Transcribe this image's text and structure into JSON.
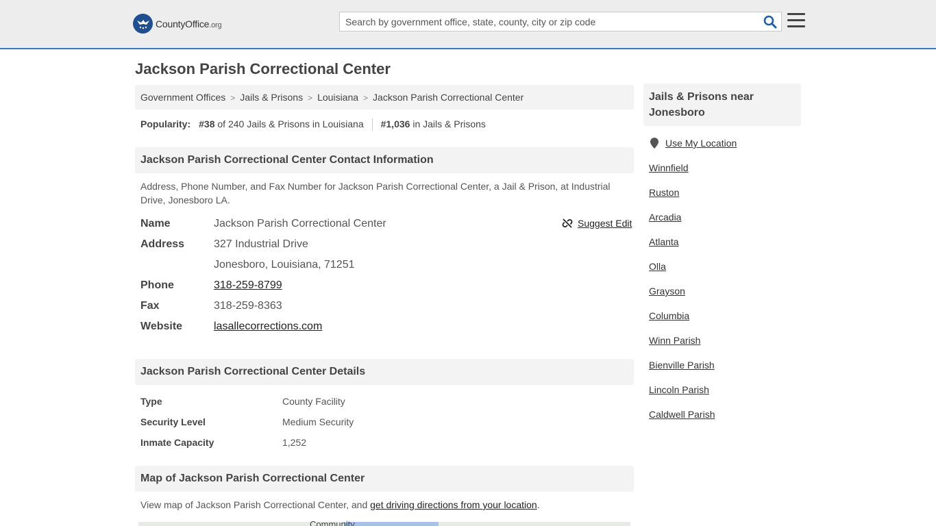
{
  "header": {
    "logo_text_main": "CountyOffice",
    "logo_text_org": ".org",
    "search_placeholder": "Search by government office, state, county, city or zip code"
  },
  "page_title": "Jackson Parish Correctional Center",
  "breadcrumb": [
    "Government Offices",
    "Jails & Prisons",
    "Louisiana",
    "Jackson Parish Correctional Center"
  ],
  "popularity": {
    "label": "Popularity:",
    "state_rank": "#38",
    "state_rank_text": "of 240 Jails & Prisons in Louisiana",
    "national_rank": "#1,036",
    "national_rank_text": "in Jails & Prisons"
  },
  "contact": {
    "heading": "Jackson Parish Correctional Center Contact Information",
    "description": "Address, Phone Number, and Fax Number for Jackson Parish Correctional Center, a Jail & Prison, at Industrial Drive, Jonesboro LA.",
    "suggest_edit": "Suggest Edit",
    "name_label": "Name",
    "name_value": "Jackson Parish Correctional Center",
    "address_label": "Address",
    "address_line1": "327 Industrial Drive",
    "address_line2": "Jonesboro, Louisiana, 71251",
    "phone_label": "Phone",
    "phone_value": "318-259-8799",
    "fax_label": "Fax",
    "fax_value": "318-259-8363",
    "website_label": "Website",
    "website_value": "lasallecorrections.com"
  },
  "details": {
    "heading": "Jackson Parish Correctional Center Details",
    "rows": [
      {
        "label": "Type",
        "value": "County Facility"
      },
      {
        "label": "Security Level",
        "value": "Medium Security"
      },
      {
        "label": "Inmate Capacity",
        "value": "1,252"
      }
    ]
  },
  "map": {
    "heading": "Map of Jackson Parish Correctional Center",
    "desc_prefix": "View map of Jackson Parish Correctional Center, and ",
    "desc_link": "get driving directions from your location",
    "desc_suffix": ".",
    "partial_label": "Community"
  },
  "sidebar": {
    "heading": "Jails & Prisons near Jonesboro",
    "use_location": "Use My Location",
    "links": [
      "Winnfield",
      "Ruston",
      "Arcadia",
      "Atlanta",
      "Olla",
      "Grayson",
      "Columbia",
      "Winn Parish",
      "Bienville Parish",
      "Lincoln Parish",
      "Caldwell Parish"
    ]
  },
  "colors": {
    "header_bg": "#ededed",
    "header_border": "#3c78b5",
    "logo_blue": "#1f4f8f",
    "search_icon": "#1f5fa8",
    "section_bg": "#f3f3f3"
  }
}
